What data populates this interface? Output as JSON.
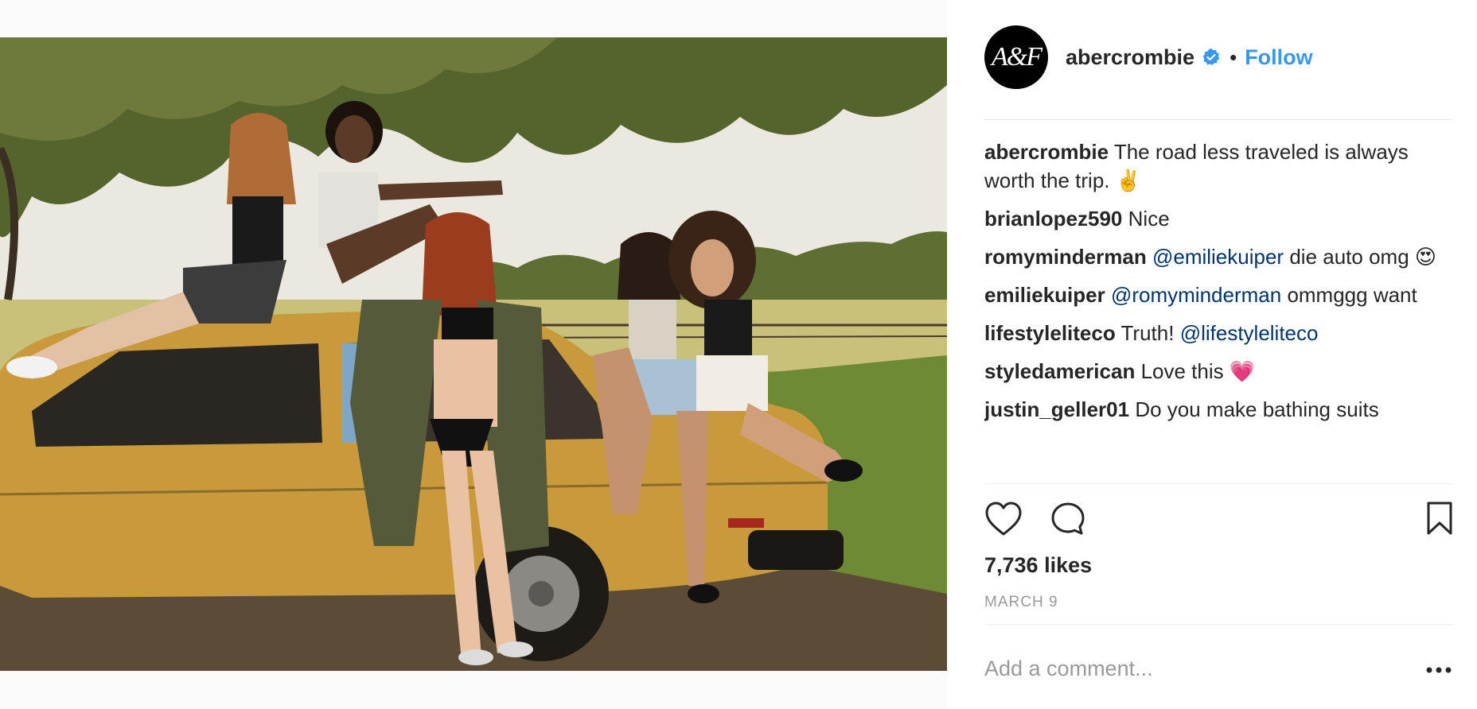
{
  "post": {
    "photo_alt": "Five women posing on and around a mustard-yellow vintage car under an oak tree",
    "account": {
      "username": "abercrombie",
      "avatar_letters": "A&F",
      "verified_icon": "verified-badge-icon",
      "separator": "•",
      "follow_label": "Follow"
    },
    "comments": [
      {
        "user": "abercrombie",
        "text": "The road less traveled is always worth the trip. ✌️"
      },
      {
        "user": "brianlopez590",
        "text": "Nice"
      },
      {
        "user": "romyminderman",
        "mention": "@emiliekuiper",
        "text": "die auto omg 😍"
      },
      {
        "user": "emiliekuiper",
        "mention": "@romyminderman",
        "text": "ommggg want"
      },
      {
        "user": "lifestyleliteco",
        "text": "Truth!",
        "mention": "@lifestyleliteco"
      },
      {
        "user": "styledamerican",
        "text": "Love this 💗"
      },
      {
        "user": "justin_geller01",
        "text": "Do you make bathing suits"
      }
    ],
    "actions": {
      "like_icon": "heart-icon",
      "comment_icon": "comment-bubble-icon",
      "save_icon": "bookmark-icon"
    },
    "likes_text": "7,736 likes",
    "date_text": "MARCH 9",
    "add_comment_placeholder": "Add a comment...",
    "more_icon": "more-options-icon"
  },
  "colors": {
    "link_blue": "#3897f0",
    "mention_blue": "#003569",
    "text_dark": "#262626",
    "text_muted": "#999999",
    "car_mustard": "#c99a3c"
  }
}
